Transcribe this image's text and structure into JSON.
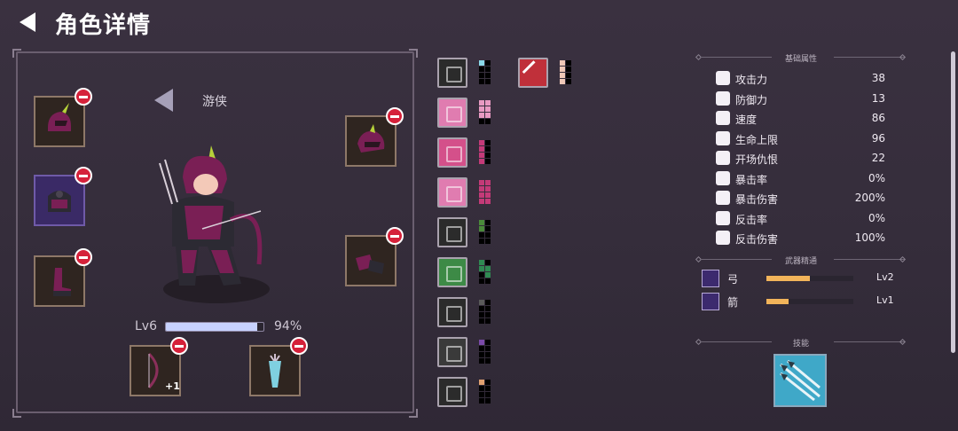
{
  "header": {
    "title": "角色详情"
  },
  "character": {
    "class_name": "游侠",
    "level_label": "Lv6",
    "xp_percent_label": "94%",
    "xp_fraction": 0.94,
    "bag_bonus": "+1"
  },
  "slots_left": [
    {
      "name": "helmet-slot",
      "icon": "helmet-icon",
      "highlight": false
    },
    {
      "name": "armor-slot",
      "icon": "armor-icon",
      "highlight": true
    },
    {
      "name": "boots-slot",
      "icon": "boots-icon",
      "highlight": false
    }
  ],
  "slots_right": [
    {
      "name": "hood-slot",
      "icon": "hood-icon"
    },
    {
      "name": "gloves-slot",
      "icon": "gloves-icon"
    }
  ],
  "slots_bottom": [
    {
      "name": "bow-slot",
      "icon": "bow-icon",
      "badge": "+1"
    },
    {
      "name": "quiver-slot",
      "icon": "quiver-icon"
    }
  ],
  "item_column": [
    {
      "icon": "skill-scroll-icon",
      "tile": "#2b2b2b",
      "pips": [
        "#8ad8e8",
        "#000",
        "#000",
        "#000",
        "#000",
        "#000",
        "#000",
        "#000"
      ]
    },
    {
      "icon": "boot-skill-icon",
      "tile": "#e07cb0",
      "pips": [
        "#e89ac2",
        "#e89ac2",
        "#e89ac2",
        "#e89ac2",
        "#e89ac2",
        "#e89ac2",
        "#000",
        "#000"
      ]
    },
    {
      "icon": "claw-skill-icon",
      "tile": "#d4508a",
      "pips": [
        "#c43a78",
        "#000",
        "#c43a78",
        "#000",
        "#c43a78",
        "#000",
        "#c43a78",
        "#000"
      ]
    },
    {
      "icon": "arrow-skill-icon",
      "tile": "#e07cb0",
      "pips": [
        "#c43a78",
        "#c43a78",
        "#c43a78",
        "#c43a78",
        "#c43a78",
        "#c43a78",
        "#c43a78",
        "#c43a78"
      ]
    },
    {
      "icon": "helm-skill-icon",
      "tile": "#2b2b2b",
      "pips": [
        "#4a8a3a",
        "#000",
        "#4a8a3a",
        "#000",
        "#000",
        "#000",
        "#000",
        "#000"
      ]
    },
    {
      "icon": "forest-skill-icon",
      "tile": "#3d8a46",
      "pips": [
        "#2f8a52",
        "#000",
        "#2f8a52",
        "#2f8a52",
        "#000",
        "#2f8a52",
        "#000",
        "#000"
      ]
    },
    {
      "icon": "wind-skill-icon",
      "tile": "#2b2b2b",
      "pips": [
        "#5a5a5a",
        "#000",
        "#000",
        "#000",
        "#000",
        "#000",
        "#000",
        "#000"
      ]
    },
    {
      "icon": "coins-skill-icon",
      "tile": "#3a3a3a",
      "pips": [
        "#7a4aa8",
        "#000",
        "#000",
        "#000",
        "#000",
        "#000",
        "#000",
        "#000"
      ]
    },
    {
      "icon": "orb-skill-icon",
      "tile": "#2b2b2b",
      "pips": [
        "#e0a070",
        "#000",
        "#000",
        "#000",
        "#000",
        "#000",
        "#000",
        "#000"
      ]
    }
  ],
  "featured_item": {
    "icon": "crossed-swords-icon",
    "tile": "#c0303a",
    "pips": [
      "#f0c8b8",
      "#000",
      "#f0c8b8",
      "#000",
      "#f0c8b8",
      "#000",
      "#f0c8b8",
      "#000"
    ]
  },
  "sections": {
    "base_attrs": "基础属性",
    "weapon_mastery": "武器精通",
    "skills": "技能"
  },
  "stats": [
    {
      "label": "攻击力",
      "value": "38",
      "icon": "sword-icon"
    },
    {
      "label": "防御力",
      "value": "13",
      "icon": "shield-icon"
    },
    {
      "label": "速度",
      "value": "86",
      "icon": "boot-speed-icon"
    },
    {
      "label": "生命上限",
      "value": "96",
      "icon": "heart-icon"
    },
    {
      "label": "开场仇恨",
      "value": "22",
      "icon": "skull-icon"
    },
    {
      "label": "暴击率",
      "value": "0%",
      "icon": "crit-burst-icon"
    },
    {
      "label": "暴击伤害",
      "value": "200%",
      "icon": "crit-damage-icon"
    },
    {
      "label": "反击率",
      "value": "0%",
      "icon": "counter-icon"
    },
    {
      "label": "反击伤害",
      "value": "100%",
      "icon": "counter-damage-icon"
    }
  ],
  "weapons": [
    {
      "label": "弓",
      "level": "Lv2",
      "fraction": 0.5,
      "icon": "bow-mastery-icon"
    },
    {
      "label": "箭",
      "level": "Lv1",
      "fraction": 0.25,
      "icon": "arrow-mastery-icon"
    }
  ],
  "colors": {
    "accent_red": "#d5213a",
    "xp_fill": "#c7d2ff",
    "mastery_fill": "#f2b45a"
  }
}
